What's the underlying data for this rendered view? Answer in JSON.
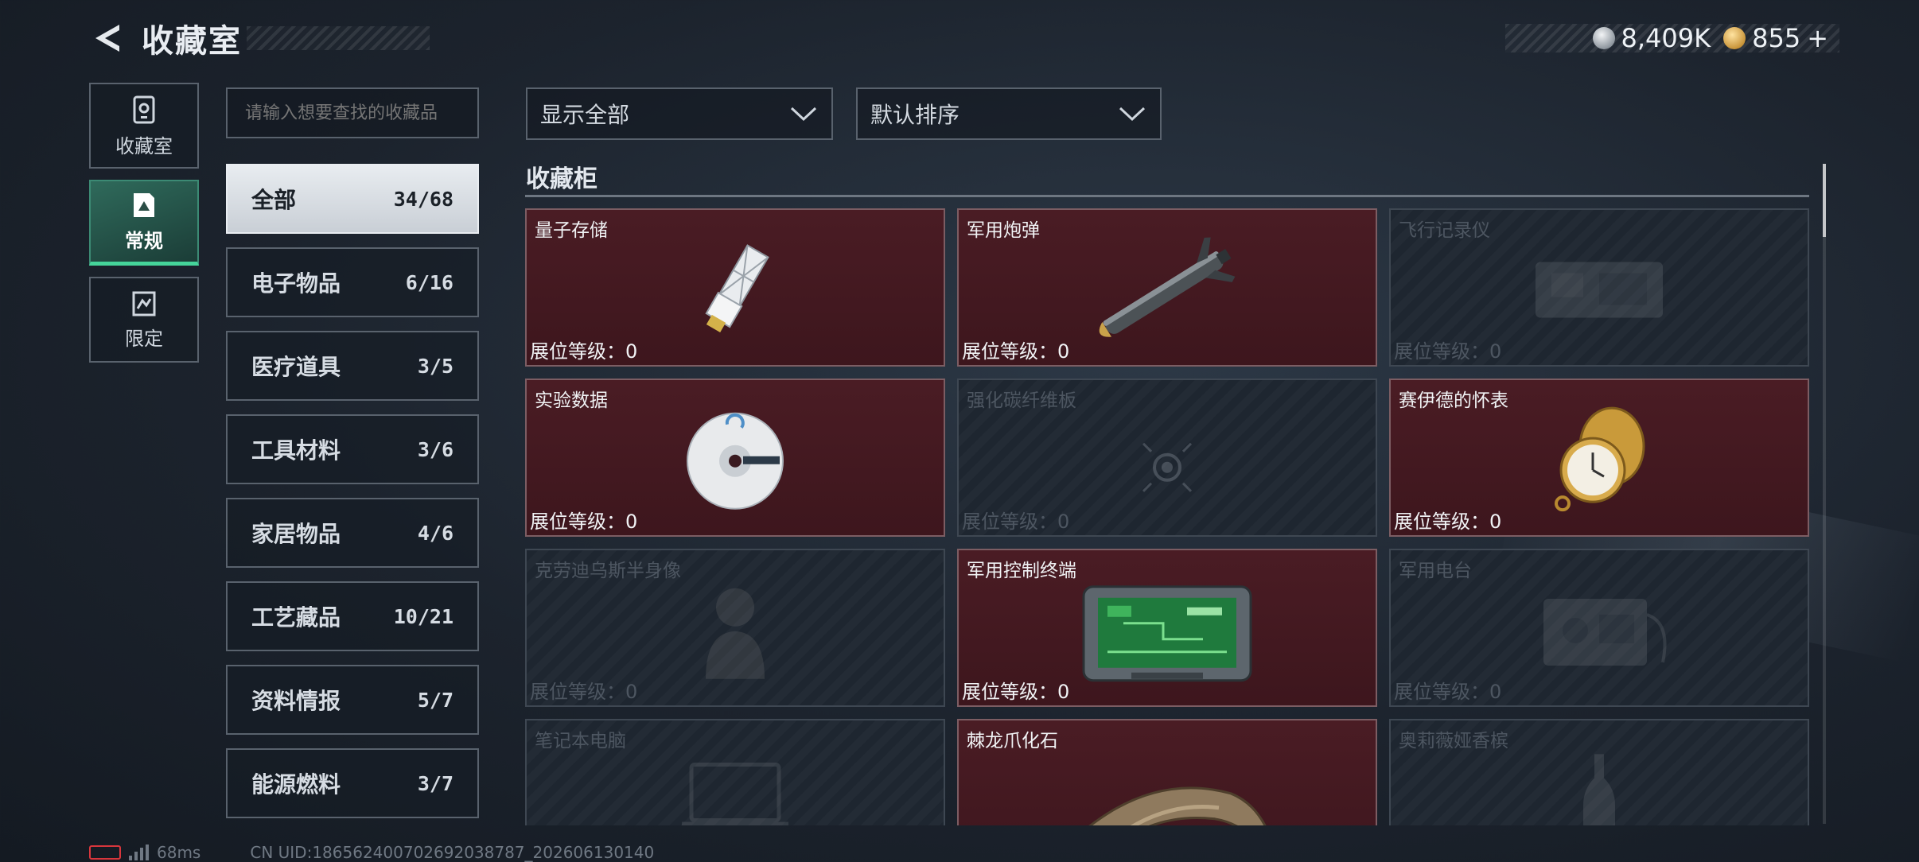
{
  "header": {
    "title": "收藏室",
    "currency_1": "8,409K",
    "currency_2": "855",
    "currency_add": "+"
  },
  "side_nav": [
    {
      "label": "收藏室",
      "icon": "collection-room-icon",
      "active": false
    },
    {
      "label": "常规",
      "icon": "regular-icon",
      "active": true
    },
    {
      "label": "限定",
      "icon": "limited-icon",
      "active": false
    }
  ],
  "search": {
    "placeholder": "请输入想要查找的收藏品"
  },
  "categories": [
    {
      "label": "全部",
      "count": "34/68",
      "active": true
    },
    {
      "label": "电子物品",
      "count": "6/16"
    },
    {
      "label": "医疗道具",
      "count": "3/5"
    },
    {
      "label": "工具材料",
      "count": "3/6"
    },
    {
      "label": "家居物品",
      "count": "4/6"
    },
    {
      "label": "工艺藏品",
      "count": "10/21"
    },
    {
      "label": "资料情报",
      "count": "5/7"
    },
    {
      "label": "能源燃料",
      "count": "3/7"
    }
  ],
  "filters": {
    "display": "显示全部",
    "sort": "默认排序"
  },
  "section_title": "收藏柜",
  "level_label": "展位等级：",
  "items": [
    {
      "name": "量子存储",
      "level": "0",
      "owned": true,
      "icon": "usb-drive-icon"
    },
    {
      "name": "军用炮弹",
      "level": "0",
      "owned": true,
      "icon": "missile-icon"
    },
    {
      "name": "飞行记录仪",
      "level": "0",
      "owned": false,
      "icon": "flight-recorder-icon"
    },
    {
      "name": "实验数据",
      "level": "0",
      "owned": true,
      "icon": "disc-icon"
    },
    {
      "name": "强化碳纤维板",
      "level": "0",
      "owned": false,
      "icon": "target-icon"
    },
    {
      "name": "赛伊德的怀表",
      "level": "0",
      "owned": true,
      "icon": "pocket-watch-icon"
    },
    {
      "name": "克劳迪乌斯半身像",
      "level": "0",
      "owned": false,
      "icon": "bust-icon"
    },
    {
      "name": "军用控制终端",
      "level": "0",
      "owned": true,
      "icon": "control-terminal-icon"
    },
    {
      "name": "军用电台",
      "level": "0",
      "owned": false,
      "icon": "radio-icon"
    },
    {
      "name": "笔记本电脑",
      "level": "",
      "owned": false,
      "icon": "laptop-icon"
    },
    {
      "name": "棘龙爪化石",
      "level": "",
      "owned": true,
      "icon": "claw-fossil-icon"
    },
    {
      "name": "奥莉薇娅香槟",
      "level": "",
      "owned": false,
      "icon": "champagne-icon"
    }
  ],
  "footer": {
    "ping": "68ms",
    "uid": "CN UID:186562400702692038787_202606130140"
  }
}
